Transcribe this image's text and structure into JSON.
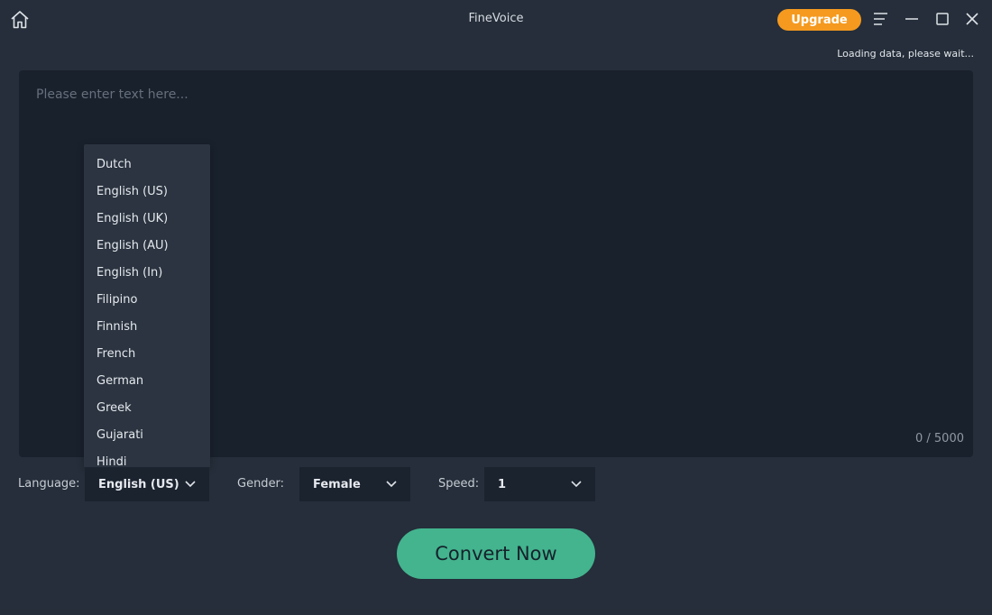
{
  "app": {
    "title": "FineVoice"
  },
  "header": {
    "upgrade_label": "Upgrade",
    "loading_text": "Loading data, please wait...",
    "icons": {
      "home": "home-icon",
      "menu": "menu-icon",
      "minimize": "minimize-icon",
      "maximize": "maximize-icon",
      "close": "close-icon"
    }
  },
  "editor": {
    "placeholder": "Please enter text here...",
    "value": "",
    "char_count": "0 / 5000"
  },
  "language_dropdown": {
    "options": [
      "Dutch",
      "English (US)",
      "English (UK)",
      "English (AU)",
      "English (In)",
      "Filipino",
      "Finnish",
      "French",
      "German",
      "Greek",
      "Gujarati",
      "Hindi"
    ]
  },
  "controls": {
    "language_label": "Language:",
    "language_value": "English (US)",
    "gender_label": "Gender:",
    "gender_value": "Female",
    "speed_label": "Speed:",
    "speed_value": "1"
  },
  "convert_label": "Convert Now",
  "colors": {
    "background": "#252e3a",
    "editor_bg": "#19212d",
    "upgrade": "#f59a1f",
    "convert": "#43b48e"
  }
}
